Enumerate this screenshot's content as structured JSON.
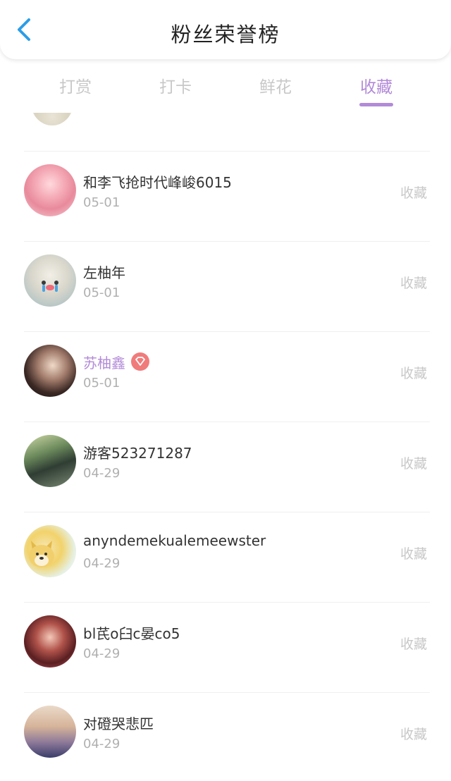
{
  "header": {
    "title": "粉丝荣誉榜"
  },
  "tabs": [
    {
      "label": "打赏",
      "active": false
    },
    {
      "label": "打卡",
      "active": false
    },
    {
      "label": "鲜花",
      "active": false
    },
    {
      "label": "收藏",
      "active": true
    }
  ],
  "colors": {
    "accent": "#b28ad8",
    "back_arrow": "#2b9de8",
    "vip_badge": "#f07b7b",
    "muted_text": "#c8c8c8"
  },
  "rows": [
    {
      "name": "和李飞抢时代峰峻6015",
      "date": "05-01",
      "action": "收藏",
      "vip": false,
      "avatar": "anime-girl-avatar"
    },
    {
      "name": "左柚年",
      "date": "05-01",
      "action": "收藏",
      "vip": false,
      "avatar": "crying-mochi-avatar"
    },
    {
      "name": "苏柚鑫",
      "date": "05-01",
      "action": "收藏",
      "vip": true,
      "avatar": "girl-portrait-avatar"
    },
    {
      "name": "游客523271287",
      "date": "04-29",
      "action": "收藏",
      "vip": false,
      "avatar": "person-outdoor-avatar"
    },
    {
      "name": "anyndemekualemeewster",
      "date": "04-29",
      "action": "收藏",
      "vip": false,
      "avatar": "doge-avatar"
    },
    {
      "name": "bl芪o臼c晏co5",
      "date": "04-29",
      "action": "收藏",
      "vip": false,
      "avatar": "woman-portrait-avatar"
    },
    {
      "name": "对磴哭悲匹",
      "date": "04-29",
      "action": "收藏",
      "vip": false,
      "avatar": "girl-selfie-avatar"
    }
  ]
}
